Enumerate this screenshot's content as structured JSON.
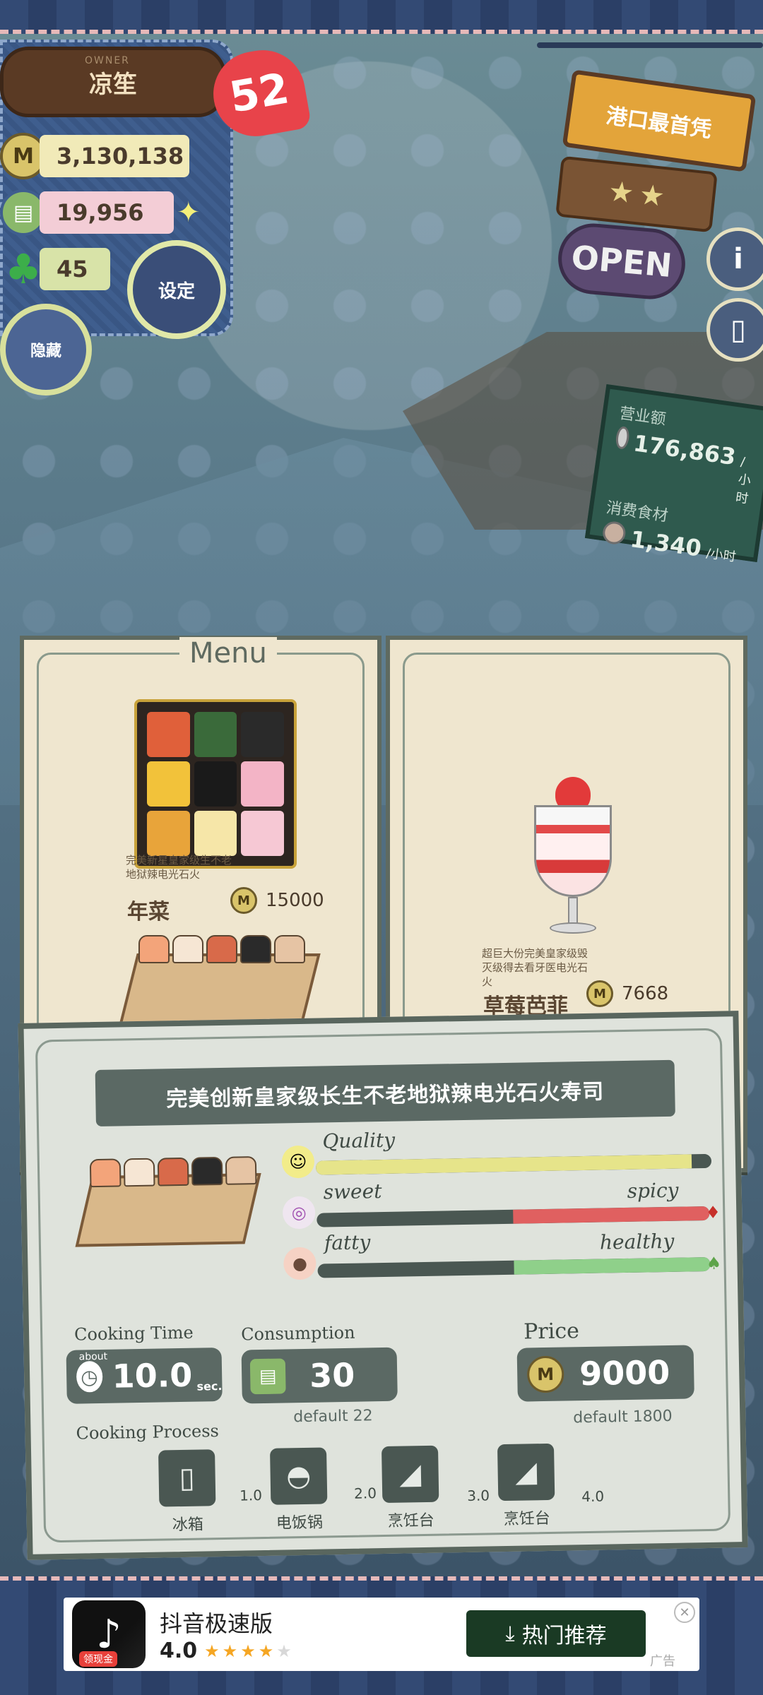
{
  "owner": {
    "label": "OWNER",
    "name": "凉笙",
    "heart_count": "52",
    "coins": "3,130,138",
    "ingredients": "19,956",
    "clovers": "45",
    "settings_label": "设定",
    "hide_label": "隐藏"
  },
  "shop": {
    "name": "港口最首凭",
    "status": "OPEN",
    "info_icon_label": "i",
    "book_icon_label": "▯",
    "revenue_label": "营业额",
    "revenue_value": "176,863",
    "revenue_unit": "/小时",
    "consumption_label": "消费食材",
    "consumption_value": "1,340",
    "consumption_unit": "/小时"
  },
  "menu": {
    "title": "Menu",
    "items": [
      {
        "name": "年菜",
        "desc": "完美新星皇家级生不老地狱辣电光石火",
        "price": "15000"
      },
      {
        "name": "草莓芭菲",
        "desc": "超巨大份完美皇家级毁灭级得去看牙医电光石火",
        "price": "7668"
      }
    ]
  },
  "detail": {
    "title": "完美创新皇家级长生不老地狱辣电光石火寿司",
    "quality_label": "Quality",
    "sweet_label": "sweet",
    "spicy_label": "spicy",
    "fatty_label": "fatty",
    "healthy_label": "healthy",
    "quality_level": 0.95,
    "spicy_level": 0.5,
    "healthy_level": 0.5,
    "cooking_time_label": "Cooking Time",
    "cooking_time_about": "about",
    "cooking_time_value": "10.0",
    "cooking_time_unit": "sec.",
    "consumption_label": "Consumption",
    "consumption_value": "30",
    "consumption_default": "default 22",
    "price_label": "Price",
    "price_value": "9000",
    "price_default": "default 1800",
    "cooking_process_label": "Cooking Process",
    "process": [
      {
        "label": "冰箱",
        "time": "1.0",
        "icon": "fridge-icon"
      },
      {
        "label": "电饭锅",
        "time": "2.0",
        "icon": "rice-cooker-icon"
      },
      {
        "label": "烹饪台",
        "time": "3.0",
        "icon": "knife-icon"
      },
      {
        "label": "烹饪台",
        "time": "4.0",
        "icon": "knife-icon"
      }
    ]
  },
  "ad": {
    "app_name": "抖音极速版",
    "rating": "4.0",
    "stars_on": "★★★★",
    "stars_off": "★",
    "logo_tag": "领现金",
    "cta_label": "热门推荐",
    "ad_tag": "广告"
  },
  "colors": {
    "accent_red": "#e8434a",
    "panel_blue": "#3f5e8e",
    "card_grey": "#5b6964",
    "quality_fill": "#e6e48a",
    "spicy_fill": "#e06060",
    "healthy_fill": "#8fd08a"
  }
}
